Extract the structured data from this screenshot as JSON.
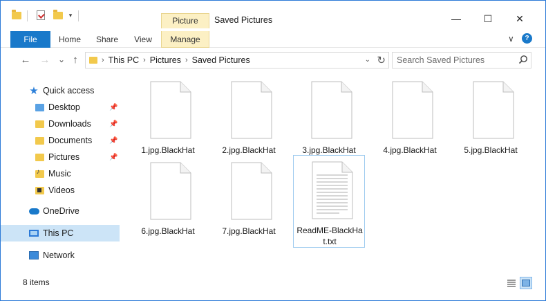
{
  "window": {
    "title": "Saved Pictures",
    "context_tab_group": "Picture Tools",
    "minimize": "—",
    "maximize": "☐",
    "close": "✕"
  },
  "quick_access_toolbar": {
    "dropdown": "▾"
  },
  "ribbon": {
    "tabs": [
      {
        "label": "File"
      },
      {
        "label": "Home"
      },
      {
        "label": "Share"
      },
      {
        "label": "View"
      },
      {
        "label": "Manage"
      }
    ],
    "collapse": "∨",
    "help": "?"
  },
  "nav": {
    "back": "←",
    "forward": "→",
    "recent": "⌄",
    "up": "↑",
    "breadcrumb": [
      "This PC",
      "Pictures",
      "Saved Pictures"
    ],
    "address_dropdown": "⌄",
    "refresh": "↻"
  },
  "search": {
    "placeholder": "Search Saved Pictures"
  },
  "sidebar": {
    "items": [
      {
        "label": "Quick access",
        "icon": "star-icon"
      },
      {
        "label": "Desktop",
        "icon": "folder-icon",
        "pinned": true
      },
      {
        "label": "Downloads",
        "icon": "download-folder-icon",
        "pinned": true
      },
      {
        "label": "Documents",
        "icon": "documents-folder-icon",
        "pinned": true
      },
      {
        "label": "Pictures",
        "icon": "pictures-folder-icon",
        "pinned": true
      },
      {
        "label": "Music",
        "icon": "music-folder-icon"
      },
      {
        "label": "Videos",
        "icon": "videos-folder-icon"
      },
      {
        "label": "OneDrive",
        "icon": "cloud-icon"
      },
      {
        "label": "This PC",
        "icon": "computer-icon",
        "selected": true
      },
      {
        "label": "Network",
        "icon": "network-icon"
      }
    ],
    "pin_glyph": "📌"
  },
  "files": [
    {
      "name": "1.jpg.BlackHat"
    },
    {
      "name": "2.jpg.BlackHat"
    },
    {
      "name": "3.jpg.BlackHat"
    },
    {
      "name": "4.jpg.BlackHat"
    },
    {
      "name": "5.jpg.BlackHat"
    },
    {
      "name": "6.jpg.BlackHat"
    },
    {
      "name": "7.jpg.BlackHat"
    },
    {
      "name": "ReadME-BlackHa",
      "name_line2": "t.txt",
      "type": "text",
      "selected": true
    }
  ],
  "status": {
    "item_count": "8 items"
  },
  "colors": {
    "accent": "#1979ca",
    "picture_tools": "#fcf0c4",
    "selection": "#cce4f7",
    "folder": "#f2c94c"
  }
}
